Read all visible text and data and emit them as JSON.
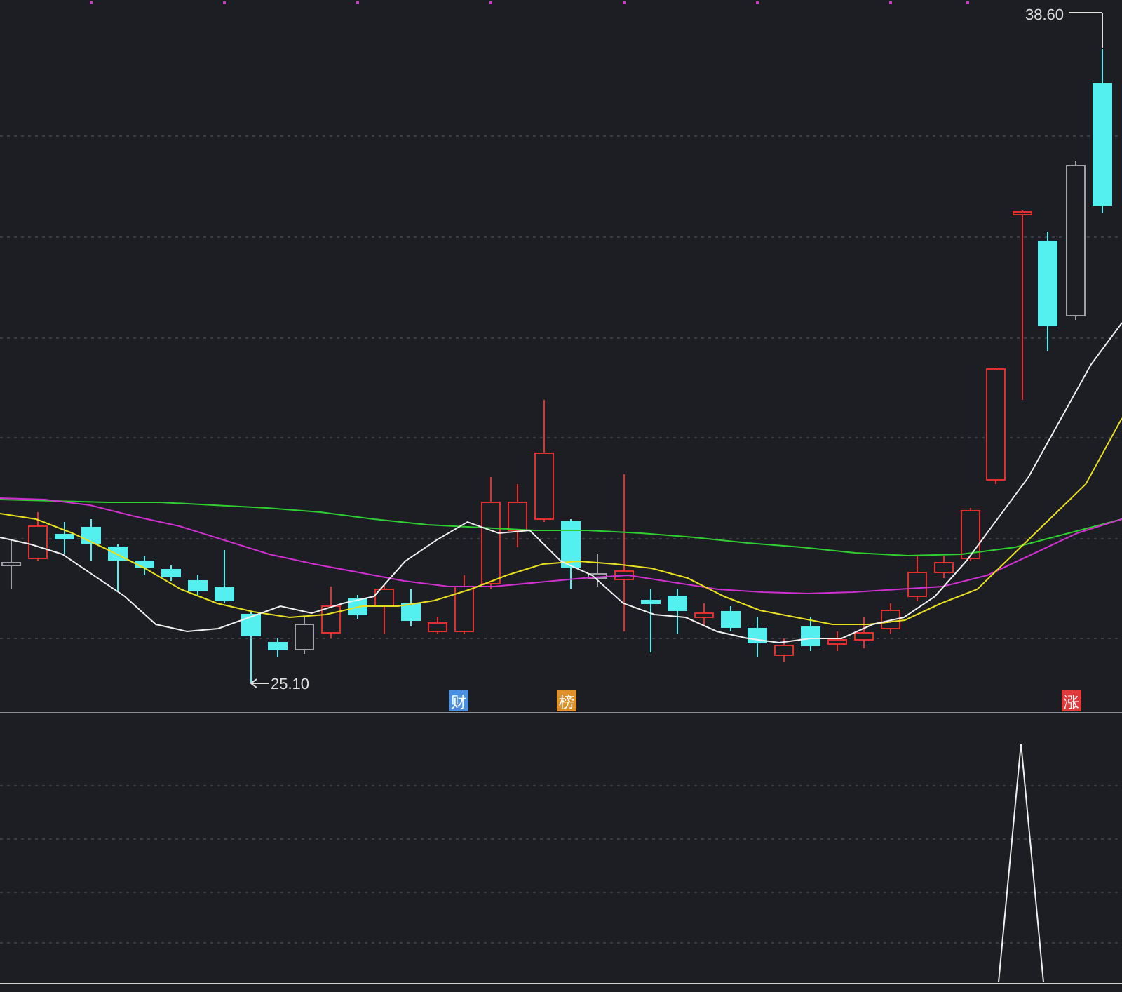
{
  "chart": {
    "high_label": "38.60",
    "low_label": "25.10",
    "markers": [
      {
        "label": "财",
        "color": "#4a8fe0"
      },
      {
        "label": "榜",
        "color": "#e0902a"
      },
      {
        "label": "涨",
        "color": "#e03a3a"
      }
    ]
  }
}
